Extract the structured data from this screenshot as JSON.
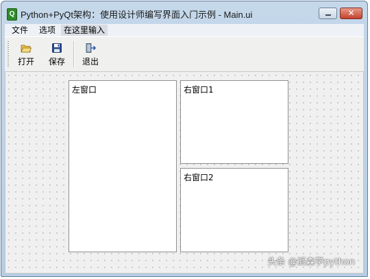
{
  "window": {
    "title": "Python+PyQt架构：使用设计师编写界面入门示例 - Main.ui",
    "close_glyph": "✕"
  },
  "menubar": {
    "items": [
      {
        "label": "文件"
      },
      {
        "label": "选项"
      },
      {
        "label": "在这里输入"
      }
    ]
  },
  "toolbar": {
    "actions": [
      {
        "label": "打开",
        "icon": "open-folder-icon"
      },
      {
        "label": "保存",
        "icon": "save-disk-icon"
      },
      {
        "label": "退出",
        "icon": "exit-door-icon"
      }
    ]
  },
  "panes": {
    "left": {
      "label": "左窗口"
    },
    "right1": {
      "label": "右窗口1"
    },
    "right2": {
      "label": "右窗口2"
    }
  },
  "watermark": "头条 @派森学python"
}
